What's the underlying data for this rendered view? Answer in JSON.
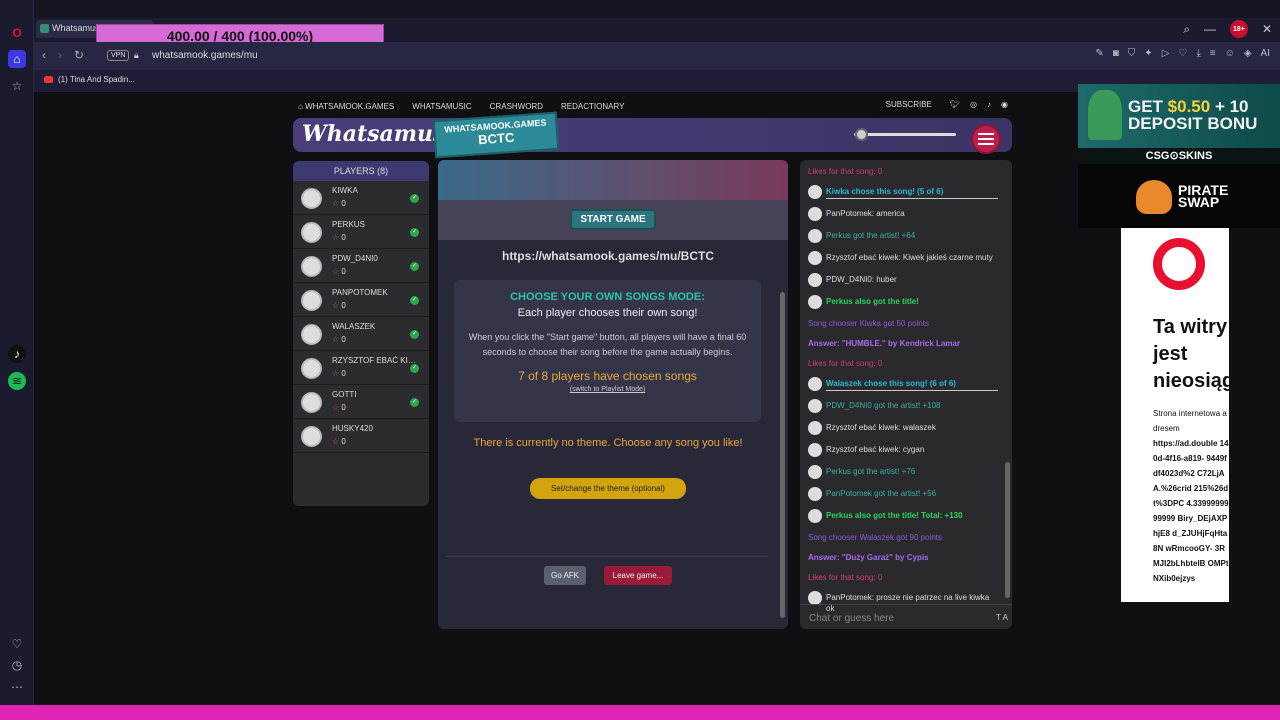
{
  "browser": {
    "tab_title": "Whatsamusic",
    "overlay_progress_text": "400.00 / 400 (100.00%)",
    "age_badge": "18+",
    "vpn_label": "VPN",
    "url": "whatsamook.games/mu",
    "bookmark": "(1) Tina And Spadin..."
  },
  "site_nav": {
    "links": [
      "WHATSAMOOK.GAMES",
      "WHATSAMUSIC",
      "CRASHWORD",
      "REDACTIONARY"
    ],
    "subscribe": "SUBSCRIBE"
  },
  "header": {
    "logo": "Whatsamusic",
    "room_tag_line1": "WHATSAMOOK.GAMES",
    "room_tag_line2": "BCTC",
    "volume_level": 0.05
  },
  "players_panel": {
    "title": "PLAYERS (8)",
    "players": [
      {
        "name": "KIWKA",
        "score": "0",
        "ready": true
      },
      {
        "name": "PERKUS",
        "score": "0",
        "ready": true
      },
      {
        "name": "PDW_D4NI0",
        "score": "0",
        "ready": true
      },
      {
        "name": "PANPOTOMEK",
        "score": "0",
        "ready": true
      },
      {
        "name": "WALASZEK",
        "score": "0",
        "ready": true
      },
      {
        "name": "RZYSZTOF EBAĆ KIW...",
        "score": "0",
        "ready": true
      },
      {
        "name": "GOTTI",
        "score": "0",
        "ready": true
      },
      {
        "name": "HUSKY420",
        "score": "0",
        "ready": false
      }
    ]
  },
  "game": {
    "start_button": "START GAME",
    "room_url": "https://whatsamook.games/mu/BCTC",
    "mode_title": "CHOOSE YOUR OWN SONGS MODE:",
    "mode_subtitle": "Each player chooses their own song!",
    "mode_description": "When you click the \"Start game\" button, all players will have a final 60 seconds to choose their song before the game actually begins.",
    "chosen_count": "7 of 8 players have chosen songs",
    "switch_link": "(switch to Playlist Mode)",
    "theme_text": "There is currently no theme. Choose any song you like!",
    "theme_button": "Set/change the theme (optional)",
    "afk_button": "Go AFK",
    "leave_button": "Leave game..."
  },
  "chat": {
    "messages": [
      {
        "text": "Likes for that song: 0",
        "style": "pink",
        "avatar": false
      },
      {
        "text": "Kiwka chose this song! (5 of 6)",
        "style": "cyan chooser-line",
        "avatar": true
      },
      {
        "text": "PanPotomek: america",
        "style": "white",
        "avatar": true
      },
      {
        "text": "Perkus got the artist! +64",
        "style": "teal",
        "avatar": true
      },
      {
        "text": "Rzysztof ebać kiwek: Kiwek jakieś czarne muty",
        "style": "white",
        "avatar": true
      },
      {
        "text": "PDW_D4NI0: huber",
        "style": "white",
        "avatar": true
      },
      {
        "text": "Perkus also got the title!",
        "style": "green",
        "avatar": true
      },
      {
        "text": "Song chooser Kiwka got 50 points",
        "style": "purple",
        "avatar": false
      },
      {
        "text": "Answer: \"HUMBLE.\" by Kendrick Lamar",
        "style": "purpleb",
        "avatar": false
      },
      {
        "text": "Likes for that song: 0",
        "style": "pink",
        "avatar": false
      },
      {
        "text": "Walaszek chose this song! (6 of 6)",
        "style": "cyan chooser-line",
        "avatar": true
      },
      {
        "text": "PDW_D4NI0 got the artist! +108",
        "style": "teal",
        "avatar": true
      },
      {
        "text": "Rzysztof ebać kiwek: walaszek",
        "style": "white",
        "avatar": true
      },
      {
        "text": "Rzysztof ebać kiwek: cygan",
        "style": "white",
        "avatar": true
      },
      {
        "text": "Perkus got the artist! +76",
        "style": "teal",
        "avatar": true
      },
      {
        "text": "PanPotomek got the artist! +56",
        "style": "teal",
        "avatar": true
      },
      {
        "text": "Perkus also got the title! Total: +130",
        "style": "green",
        "avatar": true
      },
      {
        "text": "Song chooser Walaszek got 90 points",
        "style": "purple",
        "avatar": false
      },
      {
        "text": "Answer: \"Duży Garaż\" by Cypis",
        "style": "purpleb",
        "avatar": false
      },
      {
        "text": "Likes for that song: 0",
        "style": "pink",
        "avatar": false
      },
      {
        "text": "PanPotomek: prosze nie patrzec na live kiwka ok",
        "style": "white",
        "avatar": true
      }
    ],
    "input_placeholder": "Chat or guess here",
    "text_toggle": "T A"
  },
  "ads": {
    "ad1_line1_prefix": "GET ",
    "ad1_amount": "$0.50",
    "ad1_line1_suffix": " + 10",
    "ad1_line2": "DEPOSIT BONU",
    "ad1_brand": "CSG⊙SKINS",
    "ad2_line1": "PIRATE",
    "ad2_line2": "SWAP",
    "ad3_headline": "Ta witry jest nieosiąg",
    "ad3_small_text": "Strona internetowa adresem",
    "ad3_url": "https://ad.double 140d-4f16-a819- 9449fdf4023d%2 C72LjAA.%26crid 215%26dt%3DPC 4.3399999999999 Biry_DEjAXPhjE8 d_ZJUHjFqHta8N wRmcooGY- 3RMJl2bLhbtelB OMPtNXib0ejzys"
  },
  "colors": {
    "accent_teal": "#2d7380",
    "accent_pink": "#e024b4",
    "theme_yellow": "#d4a40e",
    "leave_red": "#9a1a3a"
  }
}
